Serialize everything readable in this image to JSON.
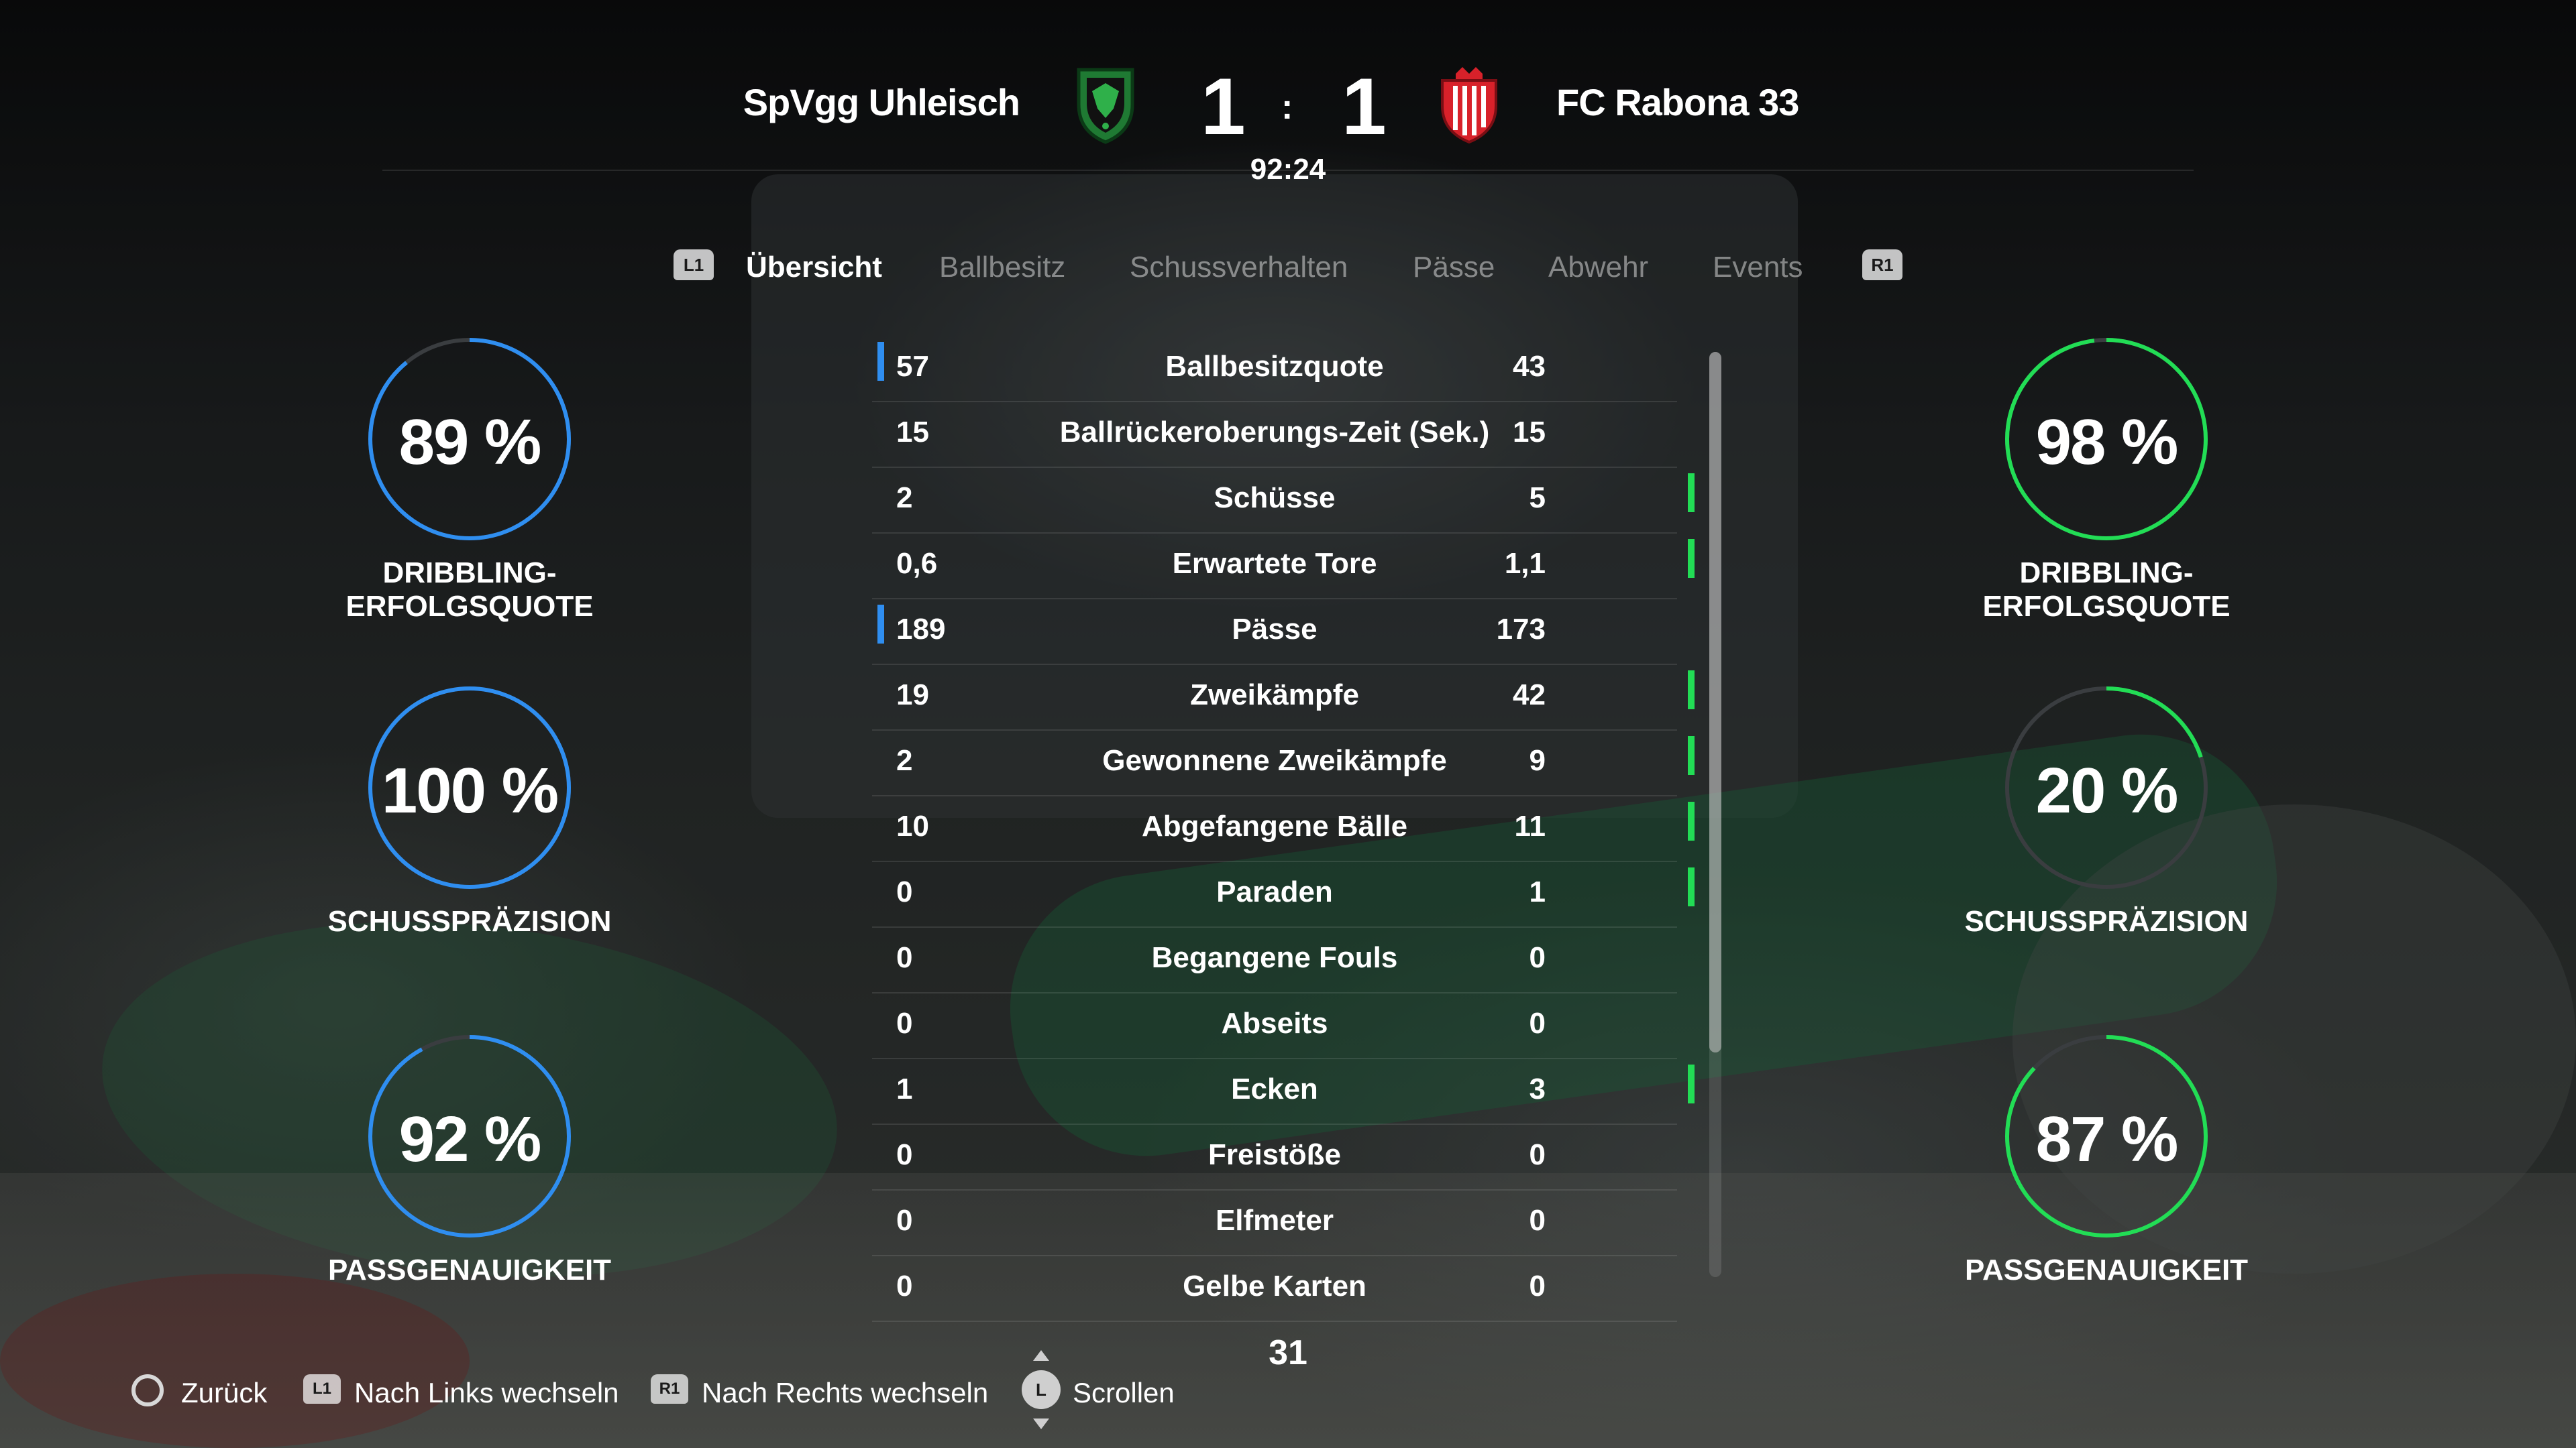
{
  "header": {
    "home_team": "SpVgg Uhleisch",
    "away_team": "FC Rabona 33",
    "home_score": "1",
    "away_score": "1",
    "separator": ":",
    "clock": "92:24"
  },
  "tabs": {
    "left_shoulder": "L1",
    "right_shoulder": "R1",
    "items": [
      {
        "label": "Übersicht",
        "active": true
      },
      {
        "label": "Ballbesitz",
        "active": false
      },
      {
        "label": "Schussverhalten",
        "active": false
      },
      {
        "label": "Pässe",
        "active": false
      },
      {
        "label": "Abwehr",
        "active": false
      },
      {
        "label": "Events",
        "active": false
      }
    ]
  },
  "gauges": {
    "home": [
      {
        "value_text": "89 %",
        "value": 89,
        "label": "DRIBBLING-ERFOLGSQUOTE"
      },
      {
        "value_text": "100 %",
        "value": 100,
        "label": "SCHUSSPRÄZISION"
      },
      {
        "value_text": "92 %",
        "value": 92,
        "label": "PASSGENAUIGKEIT"
      }
    ],
    "away": [
      {
        "value_text": "98 %",
        "value": 98,
        "label": "DRIBBLING-ERFOLGSQUOTE"
      },
      {
        "value_text": "20 %",
        "value": 20,
        "label": "SCHUSSPRÄZISION"
      },
      {
        "value_text": "87 %",
        "value": 87,
        "label": "PASSGENAUIGKEIT"
      }
    ],
    "home_color": "#2f8ef0",
    "away_color": "#22dd55",
    "track_color": "#3a3d40"
  },
  "stats": [
    {
      "home": "57",
      "name": "Ballbesitzquote",
      "away": "43",
      "leader": "home"
    },
    {
      "home": "15",
      "name": "Ballrückeroberungs-Zeit (Sek.)",
      "away": "15",
      "leader": "none"
    },
    {
      "home": "2",
      "name": "Schüsse",
      "away": "5",
      "leader": "away"
    },
    {
      "home": "0,6",
      "name": "Erwartete Tore",
      "away": "1,1",
      "leader": "away"
    },
    {
      "home": "189",
      "name": "Pässe",
      "away": "173",
      "leader": "home"
    },
    {
      "home": "19",
      "name": "Zweikämpfe",
      "away": "42",
      "leader": "away"
    },
    {
      "home": "2",
      "name": "Gewonnene Zweikämpfe",
      "away": "9",
      "leader": "away"
    },
    {
      "home": "10",
      "name": "Abgefangene Bälle",
      "away": "11",
      "leader": "away"
    },
    {
      "home": "0",
      "name": "Paraden",
      "away": "1",
      "leader": "away"
    },
    {
      "home": "0",
      "name": "Begangene Fouls",
      "away": "0",
      "leader": "none"
    },
    {
      "home": "0",
      "name": "Abseits",
      "away": "0",
      "leader": "none"
    },
    {
      "home": "1",
      "name": "Ecken",
      "away": "3",
      "leader": "away"
    },
    {
      "home": "0",
      "name": "Freistöße",
      "away": "0",
      "leader": "none"
    },
    {
      "home": "0",
      "name": "Elfmeter",
      "away": "0",
      "leader": "none"
    },
    {
      "home": "0",
      "name": "Gelbe Karten",
      "away": "0",
      "leader": "none"
    }
  ],
  "page_count": "31",
  "footer": {
    "back": {
      "icon": "circle-button-icon",
      "label": "Zurück"
    },
    "left": {
      "icon": "L1",
      "label": "Nach Links wechseln"
    },
    "right": {
      "icon": "R1",
      "label": "Nach Rechts wechseln"
    },
    "scroll": {
      "icon": "L",
      "label": "Scrollen"
    }
  }
}
